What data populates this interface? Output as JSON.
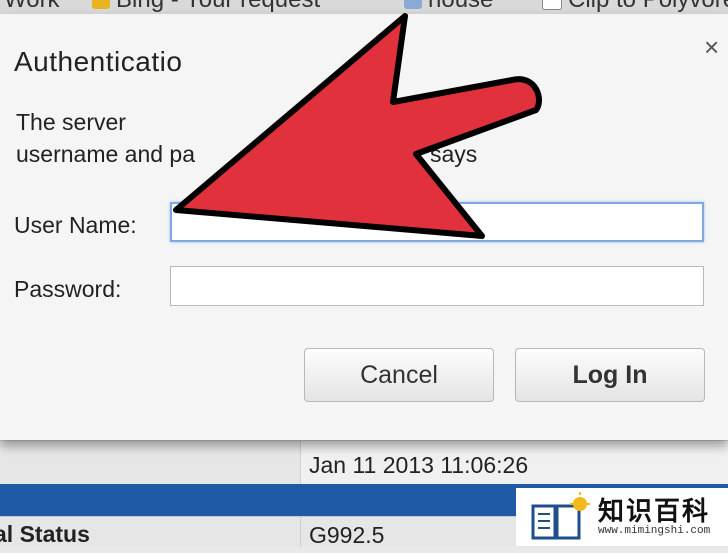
{
  "bookmarks": [
    {
      "label": "Work",
      "icon": "folder-icon"
    },
    {
      "label": "Bing - Your request",
      "icon": "bing-icon"
    },
    {
      "label": "house",
      "icon": "bookmark-icon"
    },
    {
      "label": "Clip to Polyvore",
      "icon": "page-icon"
    }
  ],
  "dialog": {
    "title": "Authenticatio",
    "close": "×",
    "message_line1": "The server",
    "message_line2": "username and pa",
    "message_says": "says",
    "username_label": "User Name:",
    "password_label": "Password:",
    "username_value": "",
    "password_value": "",
    "cancel_label": "Cancel",
    "login_label": "Log In"
  },
  "background": {
    "date": "Jan 11 2013 11:06:26",
    "status_label": "al Status",
    "status_value": "G992.5"
  },
  "watermark": {
    "brand": "知识百科",
    "url": "www.mimingshi.com"
  },
  "colors": {
    "arrow": "#e0313c",
    "focus_ring": "#7fa8e0",
    "header_bar": "#1f5aa6"
  }
}
